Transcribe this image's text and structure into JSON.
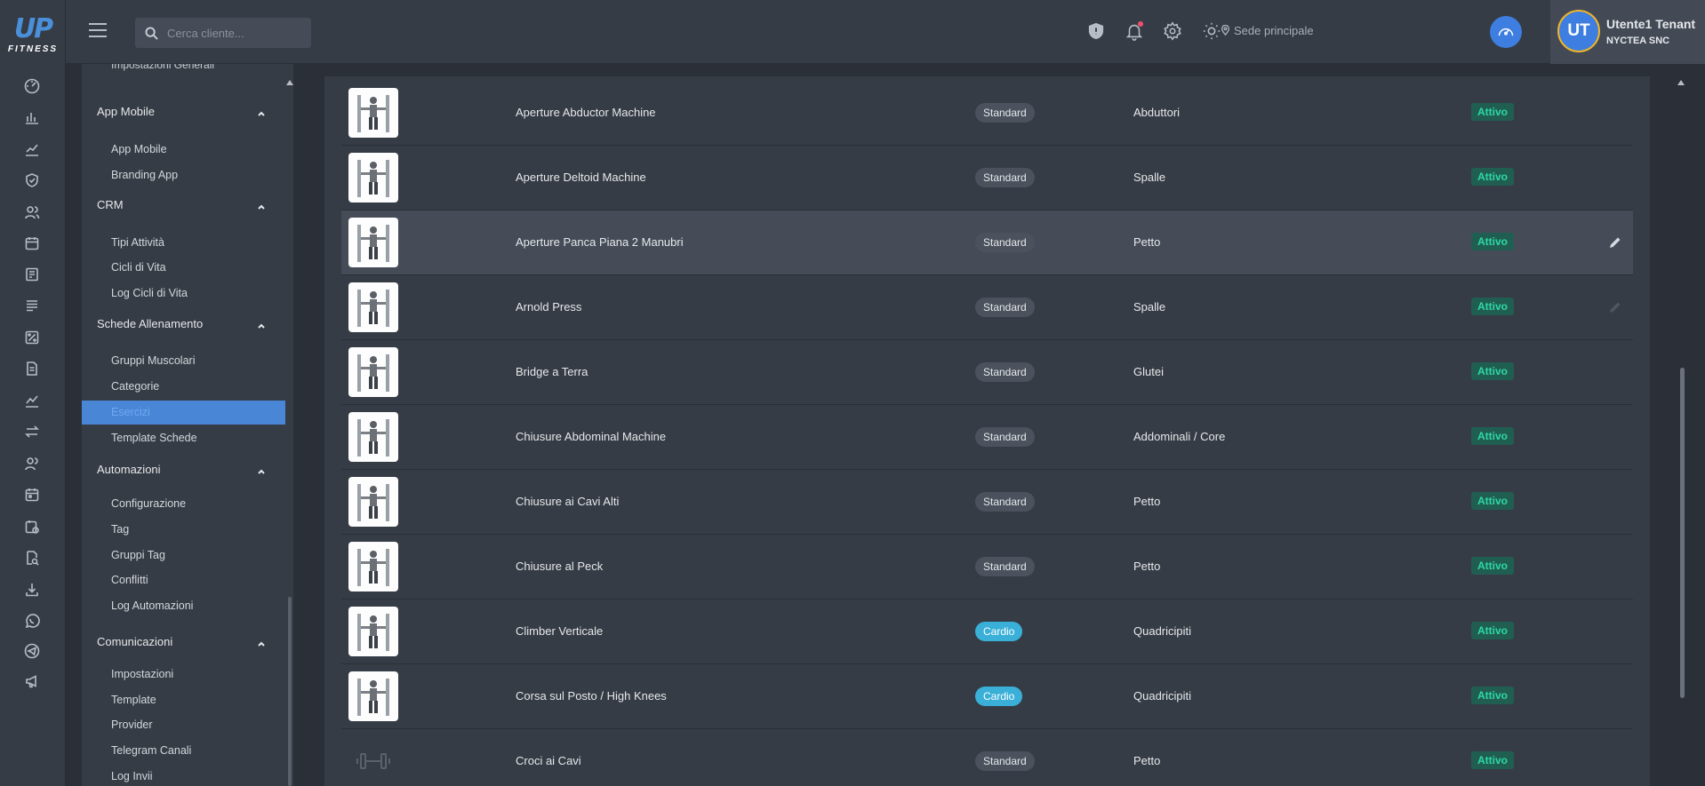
{
  "app": {
    "logo_top": "UP",
    "logo_bottom": "FITNESS"
  },
  "rail_icons": [
    "dashboard-icon",
    "bar-chart-icon",
    "line-chart-icon",
    "shield-check-icon",
    "users-icon",
    "calendar-icon",
    "book-icon",
    "list-icon",
    "percent-icon",
    "document-icon",
    "trend-icon",
    "transfer-icon",
    "users-group-icon",
    "calendar-event-icon",
    "calendar-clock-icon",
    "report-search-icon",
    "download-icon",
    "whatsapp-icon",
    "telegram-icon",
    "megaphone-icon"
  ],
  "topbar": {
    "search_placeholder": "Cerca cliente...",
    "location": "Sede principale",
    "user_initials": "UT",
    "user_name": "Utente1 Tenant",
    "user_company": "NYCTEA SNC"
  },
  "sidebar": {
    "cut_item": "Impostazioni Generali",
    "groups": [
      {
        "label": "App Mobile",
        "items": [
          "App Mobile",
          "Branding App"
        ]
      },
      {
        "label": "CRM",
        "items": [
          "Tipi Attività",
          "Cicli di Vita",
          "Log Cicli di Vita"
        ]
      },
      {
        "label": "Schede Allenamento",
        "items": [
          "Gruppi Muscolari",
          "Categorie",
          "Esercizi",
          "Template Schede"
        ]
      },
      {
        "label": "Automazioni",
        "items": [
          "Configurazione",
          "Tag",
          "Gruppi Tag",
          "Conflitti",
          "Log Automazioni"
        ]
      },
      {
        "label": "Comunicazioni",
        "items": [
          "Impostazioni",
          "Template",
          "Provider",
          "Telegram Canali",
          "Log Invii"
        ]
      }
    ],
    "active_item": "Esercizi"
  },
  "exercises": [
    {
      "name": "Aperture Abductor Machine",
      "type": "Standard",
      "muscle": "Abduttori",
      "status": "Attivo"
    },
    {
      "name": "Aperture Deltoid Machine",
      "type": "Standard",
      "muscle": "Spalle",
      "status": "Attivo"
    },
    {
      "name": "Aperture Panca Piana 2 Manubri",
      "type": "Standard",
      "muscle": "Petto",
      "status": "Attivo"
    },
    {
      "name": "Arnold Press",
      "type": "Standard",
      "muscle": "Spalle",
      "status": "Attivo"
    },
    {
      "name": "Bridge a Terra",
      "type": "Standard",
      "muscle": "Glutei",
      "status": "Attivo"
    },
    {
      "name": "Chiusure Abdominal Machine",
      "type": "Standard",
      "muscle": "Addominali / Core",
      "status": "Attivo"
    },
    {
      "name": "Chiusure ai Cavi Alti",
      "type": "Standard",
      "muscle": "Petto",
      "status": "Attivo"
    },
    {
      "name": "Chiusure al Peck",
      "type": "Standard",
      "muscle": "Petto",
      "status": "Attivo"
    },
    {
      "name": "Climber Verticale",
      "type": "Cardio",
      "muscle": "Quadricipiti",
      "status": "Attivo"
    },
    {
      "name": "Corsa sul Posto / High Knees",
      "type": "Cardio",
      "muscle": "Quadricipiti",
      "status": "Attivo"
    },
    {
      "name": "Croci ai Cavi",
      "type": "Standard",
      "muscle": "Petto",
      "status": "Attivo"
    }
  ],
  "colors": {
    "accent": "#3d7ee0",
    "cardio": "#3ab0d8",
    "active_status": "#2ed8a3"
  }
}
